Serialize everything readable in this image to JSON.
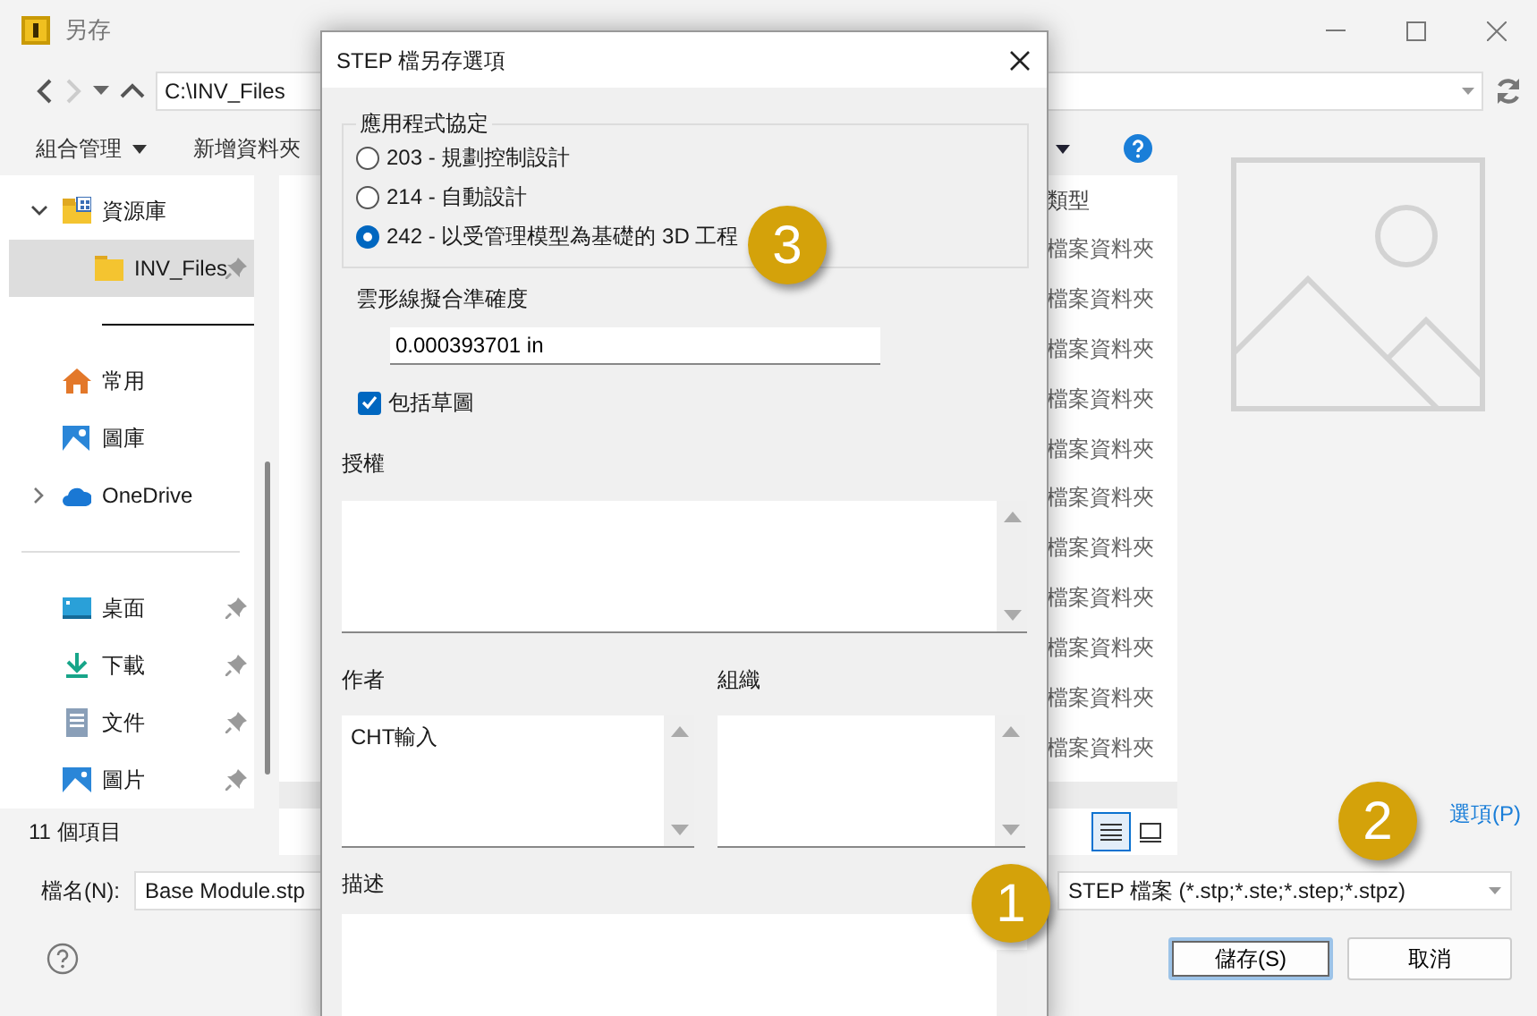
{
  "window": {
    "title": "另存"
  },
  "address": {
    "value": "C:\\INV_Files"
  },
  "toolbar": [
    {
      "label": "組合管理",
      "menu": true
    },
    {
      "label": "新增資料夾",
      "menu": false
    }
  ],
  "sidebar": {
    "sections": [
      {
        "items": [
          {
            "label": "資源庫",
            "kind": "library",
            "expanded": true,
            "pinned": false,
            "selected": false,
            "children": [
              {
                "label": "INV_Files",
                "kind": "folder",
                "pinned": true,
                "selected": true
              }
            ]
          }
        ]
      },
      {
        "items": [
          {
            "label": "常用",
            "kind": "home",
            "pinned": false,
            "selected": false
          },
          {
            "label": "圖庫",
            "kind": "gallery",
            "pinned": false,
            "selected": false
          },
          {
            "label": "OneDrive",
            "kind": "cloud",
            "expanded": false,
            "pinned": false,
            "selected": false
          }
        ]
      },
      {
        "items": [
          {
            "label": "桌面",
            "kind": "desktop",
            "pinned": true,
            "selected": false
          },
          {
            "label": "下載",
            "kind": "download",
            "pinned": true,
            "selected": false
          },
          {
            "label": "文件",
            "kind": "document",
            "pinned": true,
            "selected": false
          },
          {
            "label": "圖片",
            "kind": "picture",
            "pinned": true,
            "selected": false
          }
        ]
      }
    ]
  },
  "file_list": {
    "columns": [
      "類型"
    ],
    "rows": [
      {
        "type": "檔案資料夾"
      },
      {
        "type": "檔案資料夾"
      },
      {
        "type": "檔案資料夾"
      },
      {
        "type": "檔案資料夾"
      },
      {
        "type": "檔案資料夾"
      },
      {
        "type": "檔案資料夾"
      },
      {
        "type": "檔案資料夾"
      },
      {
        "type": "檔案資料夾"
      },
      {
        "type": "檔案資料夾"
      },
      {
        "type": "檔案資料夾"
      },
      {
        "type": "檔案資料夾"
      }
    ]
  },
  "status_bar": {
    "text": "11 個項目"
  },
  "view_buttons": [
    {
      "kind": "details",
      "selected": true
    },
    {
      "kind": "large",
      "selected": false
    }
  ],
  "options_link": "選項(P)",
  "filename": {
    "label": "檔名(N):",
    "value": "Base Module.stp"
  },
  "filetype": {
    "value": "STEP 檔案 (*.stp;*.ste;*.step;*.stpz)"
  },
  "buttons": [
    {
      "label": "儲存(S)",
      "default": true
    },
    {
      "label": "取消",
      "default": false
    }
  ],
  "dialog": {
    "title": "STEP 檔另存選項",
    "protocol": {
      "legend": "應用程式協定",
      "options": [
        {
          "label": "203 - 規劃控制設計",
          "selected": false
        },
        {
          "label": "214 - 自動設計",
          "selected": false
        },
        {
          "label": "242 - 以受管理模型為基礎的 3D 工程",
          "selected": true
        }
      ]
    },
    "tolerance": {
      "label": "雲形線擬合準確度",
      "value": "0.000393701 in"
    },
    "include_sketches": {
      "label": "包括草圖",
      "checked": true
    },
    "authorization": {
      "label": "授權"
    },
    "author": {
      "label": "作者",
      "value": "CHT輸入"
    },
    "organization": {
      "label": "組織"
    },
    "description": {
      "label": "描述"
    }
  },
  "callouts": [
    {
      "number": "1"
    },
    {
      "number": "2"
    },
    {
      "number": "3"
    }
  ]
}
